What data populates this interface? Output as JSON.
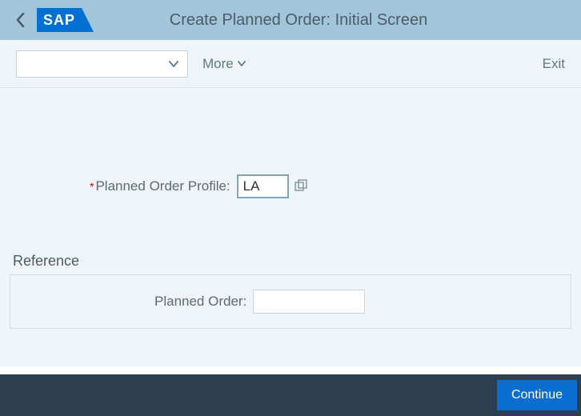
{
  "header": {
    "logo_text": "SAP",
    "title": "Create Planned Order: Initial Screen"
  },
  "toolbar": {
    "more_label": "More",
    "exit_label": "Exit"
  },
  "form": {
    "profile_label": "Planned Order Profile:",
    "profile_value": "LA",
    "reference_title": "Reference",
    "ref_order_label": "Planned Order:",
    "ref_order_value": ""
  },
  "footer": {
    "continue_label": "Continue"
  }
}
